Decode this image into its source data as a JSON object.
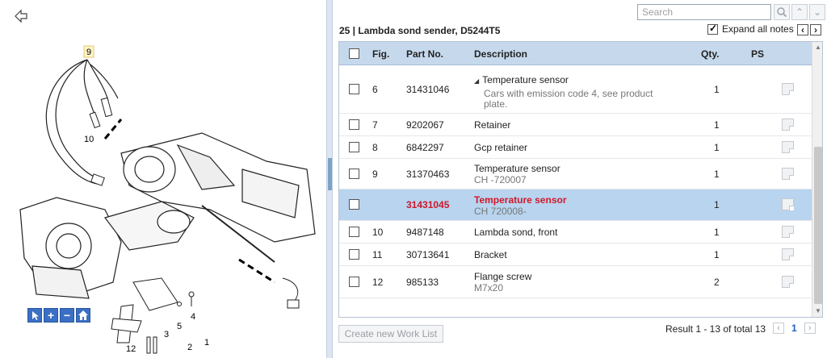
{
  "diagram": {
    "labels": [
      "9",
      "10",
      "4",
      "5",
      "3",
      "12",
      "2",
      "1"
    ]
  },
  "search": {
    "placeholder": "Search",
    "value": ""
  },
  "header": {
    "title": "25  |  Lambda sond sender, D5244T5",
    "expand_all_label": "Expand all notes",
    "expand_all_checked": true
  },
  "table": {
    "columns": {
      "fig": "Fig.",
      "part_no": "Part No.",
      "description": "Description",
      "qty": "Qty.",
      "ps": "PS"
    },
    "rows": [
      {
        "fig": "6",
        "part_no": "31431046",
        "desc1": "Temperature sensor",
        "desc2": "Cars with emission code 4, see product plate.",
        "qty": "1",
        "expanded": true
      },
      {
        "fig": "7",
        "part_no": "9202067",
        "desc1": "Retainer",
        "desc2": "",
        "qty": "1"
      },
      {
        "fig": "8",
        "part_no": "6842297",
        "desc1": "Gcp retainer",
        "desc2": "",
        "qty": "1"
      },
      {
        "fig": "9",
        "part_no": "31370463",
        "desc1": "Temperature sensor",
        "desc2": "CH -720007",
        "qty": "1"
      },
      {
        "fig": "",
        "part_no": "31431045",
        "desc1": "Temperature sensor",
        "desc2": "CH 720008-",
        "qty": "1",
        "selected": true
      },
      {
        "fig": "10",
        "part_no": "9487148",
        "desc1": "Lambda sond, front",
        "desc2": "",
        "qty": "1"
      },
      {
        "fig": "11",
        "part_no": "30713641",
        "desc1": "Bracket",
        "desc2": "",
        "qty": "1"
      },
      {
        "fig": "12",
        "part_no": "985133",
        "desc1": "Flange screw",
        "desc2": "M7x20",
        "qty": "2"
      }
    ]
  },
  "footer": {
    "worklist_label": "Create new Work List",
    "result_text": "Result 1 - 13 of total 13",
    "page": "1"
  },
  "colors": {
    "accent": "#3a6fc4",
    "selected_row": "#b8d4ef",
    "selected_text": "#d0182a",
    "header_bg": "#c6d9ec"
  },
  "icons": {
    "back": "arrow-left-icon",
    "search": "search-icon",
    "up": "chevron-up-icon",
    "down": "chevron-down-icon",
    "note": "note-icon",
    "pointer": "pointer-icon",
    "zoom_in": "plus-icon",
    "zoom_out": "minus-icon",
    "home": "home-icon"
  }
}
